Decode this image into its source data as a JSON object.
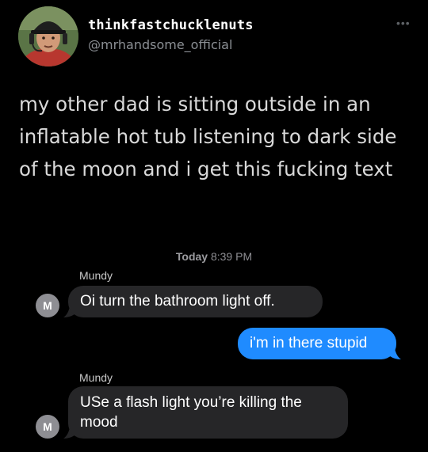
{
  "tweet": {
    "username": "thinkfastchucklenuts",
    "handle": "@mrhandsome_official",
    "more_icon": "more-dots-icon",
    "text": "my other dad is sitting outside in an inflatable hot tub listening to dark side of the moon and i get this fucking text"
  },
  "imessage": {
    "timestamp_day": "Today",
    "timestamp_time": "8:39 PM",
    "messages": [
      {
        "sender": "Mundy",
        "avatar_initial": "M",
        "direction": "incoming",
        "text": "Oi turn the bathroom light off."
      },
      {
        "direction": "outgoing",
        "text": "i'm in there stupid"
      },
      {
        "sender": "Mundy",
        "avatar_initial": "M",
        "direction": "incoming",
        "text": "USe a flash light you’re killing the mood"
      }
    ]
  },
  "colors": {
    "background": "#000000",
    "incoming_bubble": "#262628",
    "outgoing_bubble": "#1f8bff",
    "handle_text": "#8b8f94"
  }
}
